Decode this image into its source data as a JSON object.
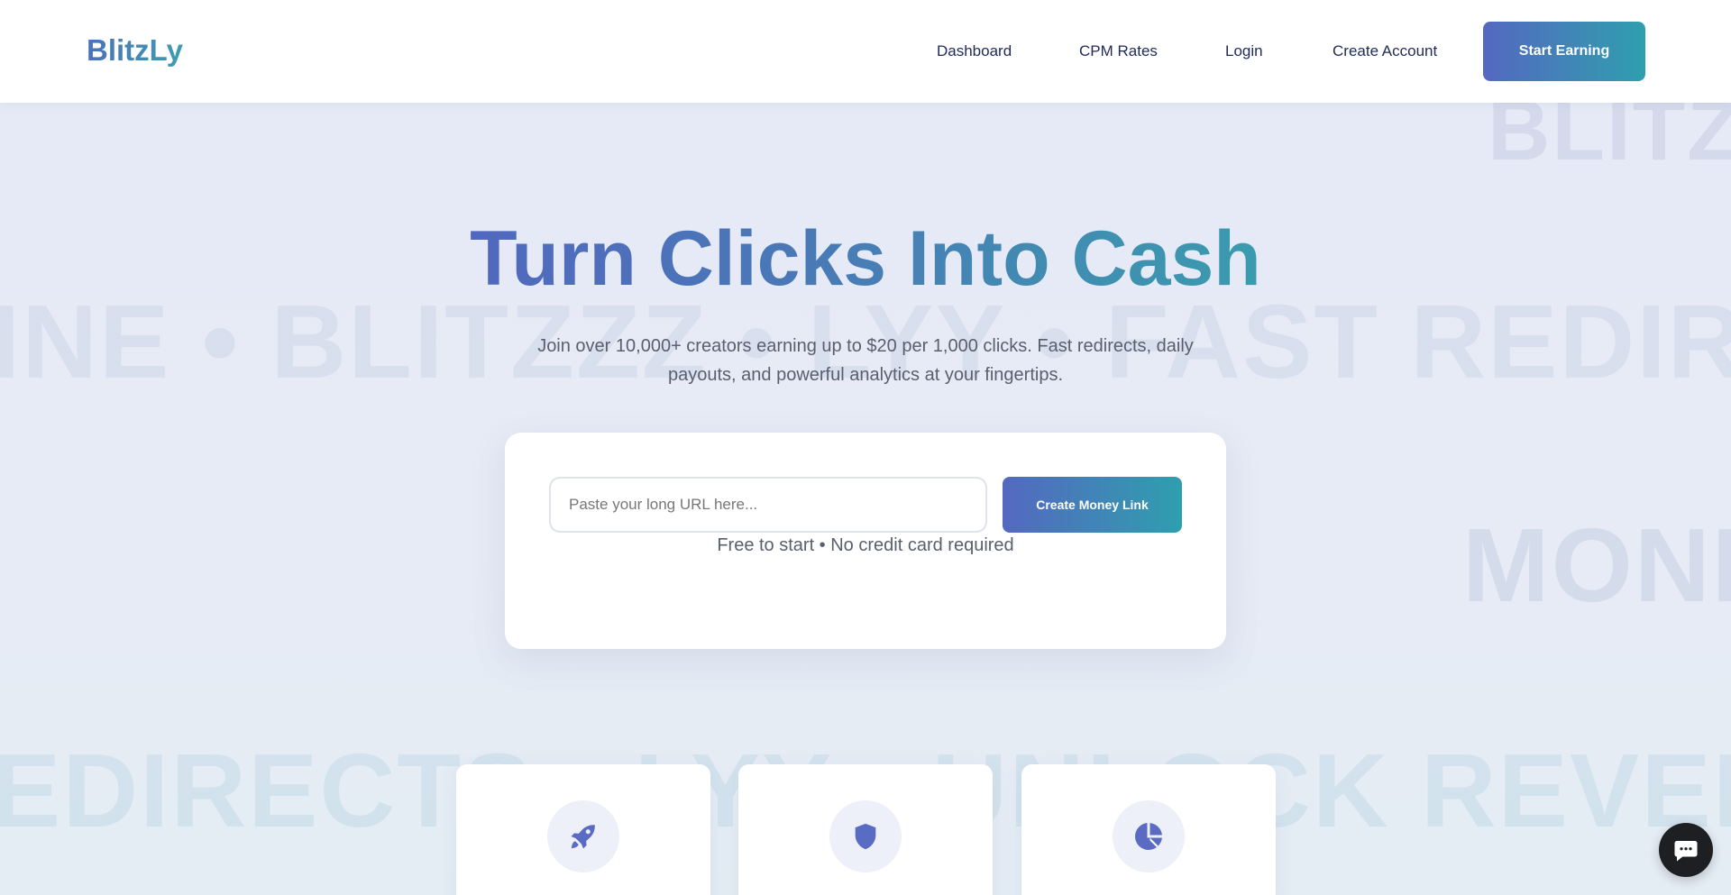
{
  "header": {
    "logo": "BlitzLy",
    "nav": {
      "dashboard": "Dashboard",
      "cpm_rates": "CPM Rates",
      "login": "Login",
      "create_account": "Create Account"
    },
    "cta": "Start Earning"
  },
  "background": {
    "line1": "BLITZ",
    "line2": "INE • BLITZZZ • LYY • FAST REDIREC",
    "line3": "MONE",
    "line4": "EDIRECTS • LYY • UNLOCK REVENU"
  },
  "hero": {
    "title": "Turn Clicks Into Cash",
    "subtitle": "Join over 10,000+ creators earning up to $20 per 1,000 clicks. Fast redirects, daily payouts, and powerful analytics at your fingertips."
  },
  "shortener": {
    "placeholder": "Paste your long URL here...",
    "button": "Create Money Link",
    "note": "Free to start • No credit card required"
  },
  "features": [
    {
      "icon": "rocket-icon"
    },
    {
      "icon": "shield-icon"
    },
    {
      "icon": "pie-chart-icon"
    }
  ],
  "chat": {
    "icon": "chat-icon"
  },
  "colors": {
    "gradient_start": "#5468c0",
    "gradient_end": "#2f9fae",
    "nav_text": "#1f2a56",
    "icon_color": "#5a6bc4"
  }
}
